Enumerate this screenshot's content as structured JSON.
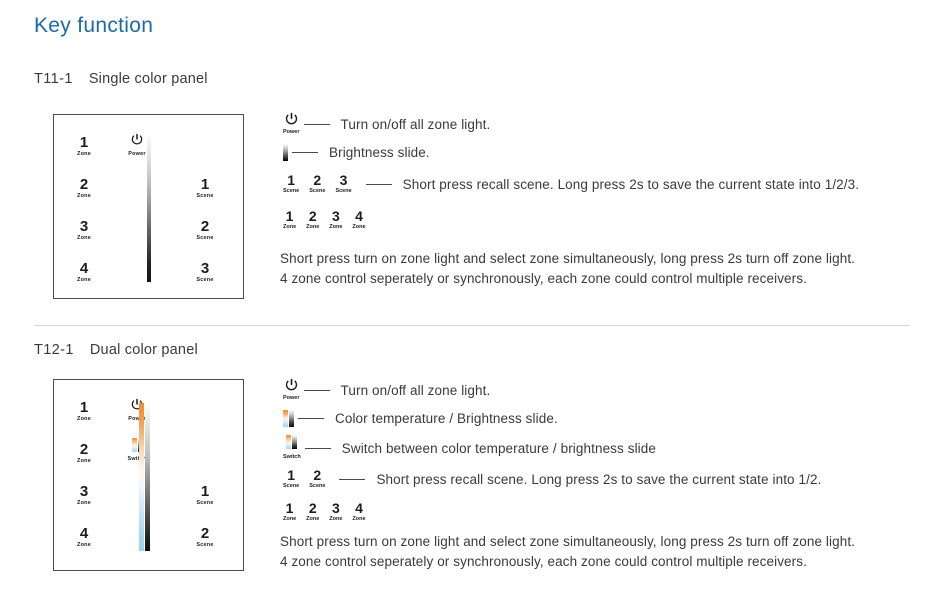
{
  "page": {
    "title": "Key function"
  },
  "sections": [
    {
      "model": "T11-1",
      "name": "Single color panel",
      "panel": {
        "zone_keys": [
          {
            "num": "1",
            "sub": "Zone"
          },
          {
            "num": "2",
            "sub": "Zone"
          },
          {
            "num": "3",
            "sub": "Zone"
          },
          {
            "num": "4",
            "sub": "Zone"
          }
        ],
        "right_keys": [
          {
            "num": "power-icon",
            "sub": "Power"
          },
          {
            "num": "1",
            "sub": "Scene"
          },
          {
            "num": "2",
            "sub": "Scene"
          },
          {
            "num": "3",
            "sub": "Scene"
          }
        ],
        "slider": "brightness-slider"
      },
      "legend": [
        {
          "icon": "power-icon",
          "icon_label": "Power",
          "text": "Turn on/off all zone light."
        },
        {
          "icon": "brightness-strip-icon",
          "icon_label": "",
          "text": "Brightness slide."
        },
        {
          "icon": "scene-keys",
          "keys": [
            {
              "num": "1",
              "sub": "Scene"
            },
            {
              "num": "2",
              "sub": "Scene"
            },
            {
              "num": "3",
              "sub": "Scene"
            }
          ],
          "text": "Short press recall scene. Long press 2s to save the current state into 1/2/3."
        }
      ],
      "zone_keys_legend": [
        {
          "num": "1",
          "sub": "Zone"
        },
        {
          "num": "2",
          "sub": "Zone"
        },
        {
          "num": "3",
          "sub": "Zone"
        },
        {
          "num": "4",
          "sub": "Zone"
        }
      ],
      "paragraph": "Short press turn on zone light and select zone simultaneously, long press 2s turn off zone light.\n4 zone control seperately or synchronously, each zone could control multiple receivers."
    },
    {
      "model": "T12-1",
      "name": "Dual color panel",
      "panel": {
        "zone_keys": [
          {
            "num": "1",
            "sub": "Zone"
          },
          {
            "num": "2",
            "sub": "Zone"
          },
          {
            "num": "3",
            "sub": "Zone"
          },
          {
            "num": "4",
            "sub": "Zone"
          }
        ],
        "right_keys": [
          {
            "num": "power-icon",
            "sub": "Power"
          },
          {
            "num": "switch-icon",
            "sub": "Switch"
          },
          {
            "num": "1",
            "sub": "Scene"
          },
          {
            "num": "2",
            "sub": "Scene"
          }
        ],
        "slider": "cct-brightness-slider"
      },
      "legend": [
        {
          "icon": "power-icon",
          "icon_label": "Power",
          "text": "Turn on/off all zone light."
        },
        {
          "icon": "dual-strip-icon",
          "icon_label": "",
          "text": "Color temperature / Brightness slide."
        },
        {
          "icon": "switch-icon",
          "icon_label": "Switch",
          "text": "Switch between color temperature / brightness slide"
        },
        {
          "icon": "scene-keys",
          "keys": [
            {
              "num": "1",
              "sub": "Scene"
            },
            {
              "num": "2",
              "sub": "Scene"
            }
          ],
          "text": "Short press recall scene. Long press 2s to save the current state into 1/2."
        }
      ],
      "zone_keys_legend": [
        {
          "num": "1",
          "sub": "Zone"
        },
        {
          "num": "2",
          "sub": "Zone"
        },
        {
          "num": "3",
          "sub": "Zone"
        },
        {
          "num": "4",
          "sub": "Zone"
        }
      ],
      "paragraph": "Short press turn on zone light and select zone simultaneously, long press 2s turn off zone light.\n4 zone control seperately or synchronously, each zone could control multiple receivers."
    }
  ],
  "colors": {
    "title": "#1d6aa6",
    "text": "#3a3a3a",
    "panel_border": "#4d4d4d",
    "divider": "#d6d6d6",
    "cct_warm": "#ef8b28",
    "cct_cool": "#a3d3ee"
  }
}
